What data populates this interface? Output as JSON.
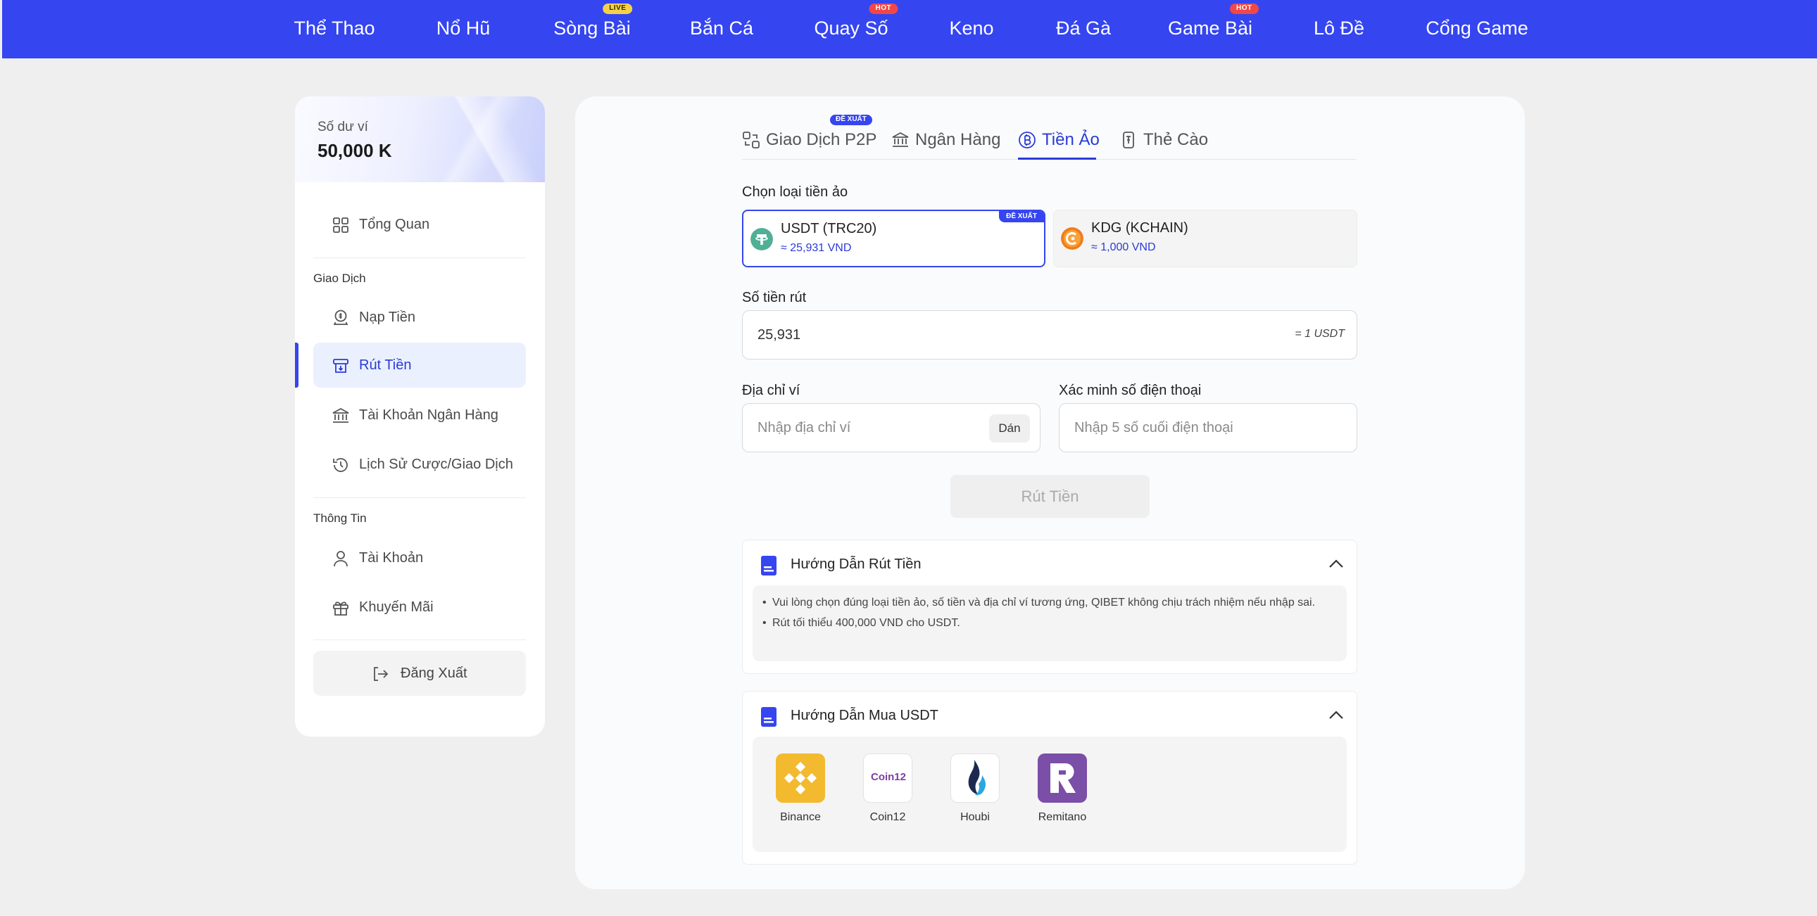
{
  "nav": {
    "items": [
      {
        "label": "Thể Thao",
        "badge": ""
      },
      {
        "label": "Nổ Hũ",
        "badge": ""
      },
      {
        "label": "Sòng Bài",
        "badge": "LIVE"
      },
      {
        "label": "Bắn Cá",
        "badge": ""
      },
      {
        "label": "Quay Số",
        "badge": "HOT"
      },
      {
        "label": "Keno",
        "badge": ""
      },
      {
        "label": "Đá Gà",
        "badge": ""
      },
      {
        "label": "Game Bài",
        "badge": "HOT"
      },
      {
        "label": "Lô Đề",
        "badge": ""
      },
      {
        "label": "Cổng Game",
        "badge": ""
      }
    ]
  },
  "sidebar": {
    "balance_label": "Số dư ví",
    "balance_value": "50,000 K",
    "overview": "Tổng Quan",
    "section_transactions": "Giao Dịch",
    "deposit": "Nạp Tiền",
    "withdraw": "Rút Tiền",
    "bank_account": "Tài Khoản Ngân Hàng",
    "history": "Lịch Sử Cược/Giao Dịch",
    "section_info": "Thông Tin",
    "account": "Tài Khoản",
    "promotions": "Khuyến Mãi",
    "logout": "Đăng Xuất"
  },
  "tabs": {
    "p2p": "Giao Dịch P2P",
    "p2p_badge": "ĐỀ XUẤT",
    "bank": "Ngân Hàng",
    "crypto": "Tiền Ảo",
    "card": "Thẻ Cào"
  },
  "form": {
    "coin_type_label": "Chọn loại tiền ảo",
    "coins": [
      {
        "name": "USDT (TRC20)",
        "rate": "≈ 25,931 VND",
        "badge": "ĐỀ XUẤT",
        "selected": true
      },
      {
        "name": "KDG (KCHAIN)",
        "rate": "≈ 1,000 VND",
        "badge": "",
        "selected": false
      }
    ],
    "amount_label": "Số tiền rút",
    "amount_value": "25,931",
    "amount_unit": "= 1 USDT",
    "wallet_label": "Địa chỉ ví",
    "wallet_placeholder": "Nhập địa chỉ ví",
    "paste": "Dán",
    "phone_label": "Xác minh số điện thoại",
    "phone_placeholder": "Nhập 5 số cuối điện thoại",
    "submit": "Rút Tiền"
  },
  "guide_withdraw": {
    "title": "Hướng Dẫn Rút Tiền",
    "items": [
      "Vui lòng chọn đúng loại tiền ảo, số tiền và địa chỉ ví tương ứng, QIBET không chịu trách nhiệm nếu nhập sai.",
      "Rút tối thiểu 400,000 VND cho USDT."
    ]
  },
  "guide_buy": {
    "title": "Hướng Dẫn Mua USDT",
    "exchanges": [
      "Binance",
      "Coin12",
      "Houbi",
      "Remitano"
    ],
    "coin12_logo_text": "Coin12"
  },
  "colors": {
    "brand": "#3545f0",
    "accent_text": "#2a3bd6",
    "usdt": "#50af95",
    "kdg": "#f07e1b",
    "binance": "#f3ba2f",
    "remitano": "#7b4ea8"
  }
}
